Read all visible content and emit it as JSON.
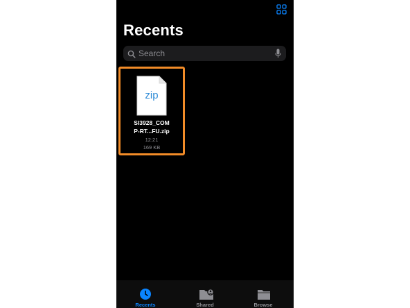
{
  "header": {
    "title": "Recents"
  },
  "search": {
    "placeholder": "Search"
  },
  "files": [
    {
      "type_label": "zip",
      "name_line1": "SI3928_COM",
      "name_line2": "P-RT...FU.zip",
      "time": "12:21",
      "size": "169 KB"
    }
  ],
  "tabs": [
    {
      "label": "Recents",
      "active": true
    },
    {
      "label": "Shared",
      "active": false
    },
    {
      "label": "Browse",
      "active": false
    }
  ],
  "colors": {
    "accent": "#0a84ff",
    "selection": "#f28c28",
    "background": "#000000",
    "inactive": "#8e8e93",
    "zip_text": "#2f8bd6"
  },
  "icons": [
    "grid-view-icon",
    "search-icon",
    "microphone-icon",
    "zip-file-icon",
    "clock-icon",
    "shared-folder-icon",
    "folder-icon"
  ]
}
